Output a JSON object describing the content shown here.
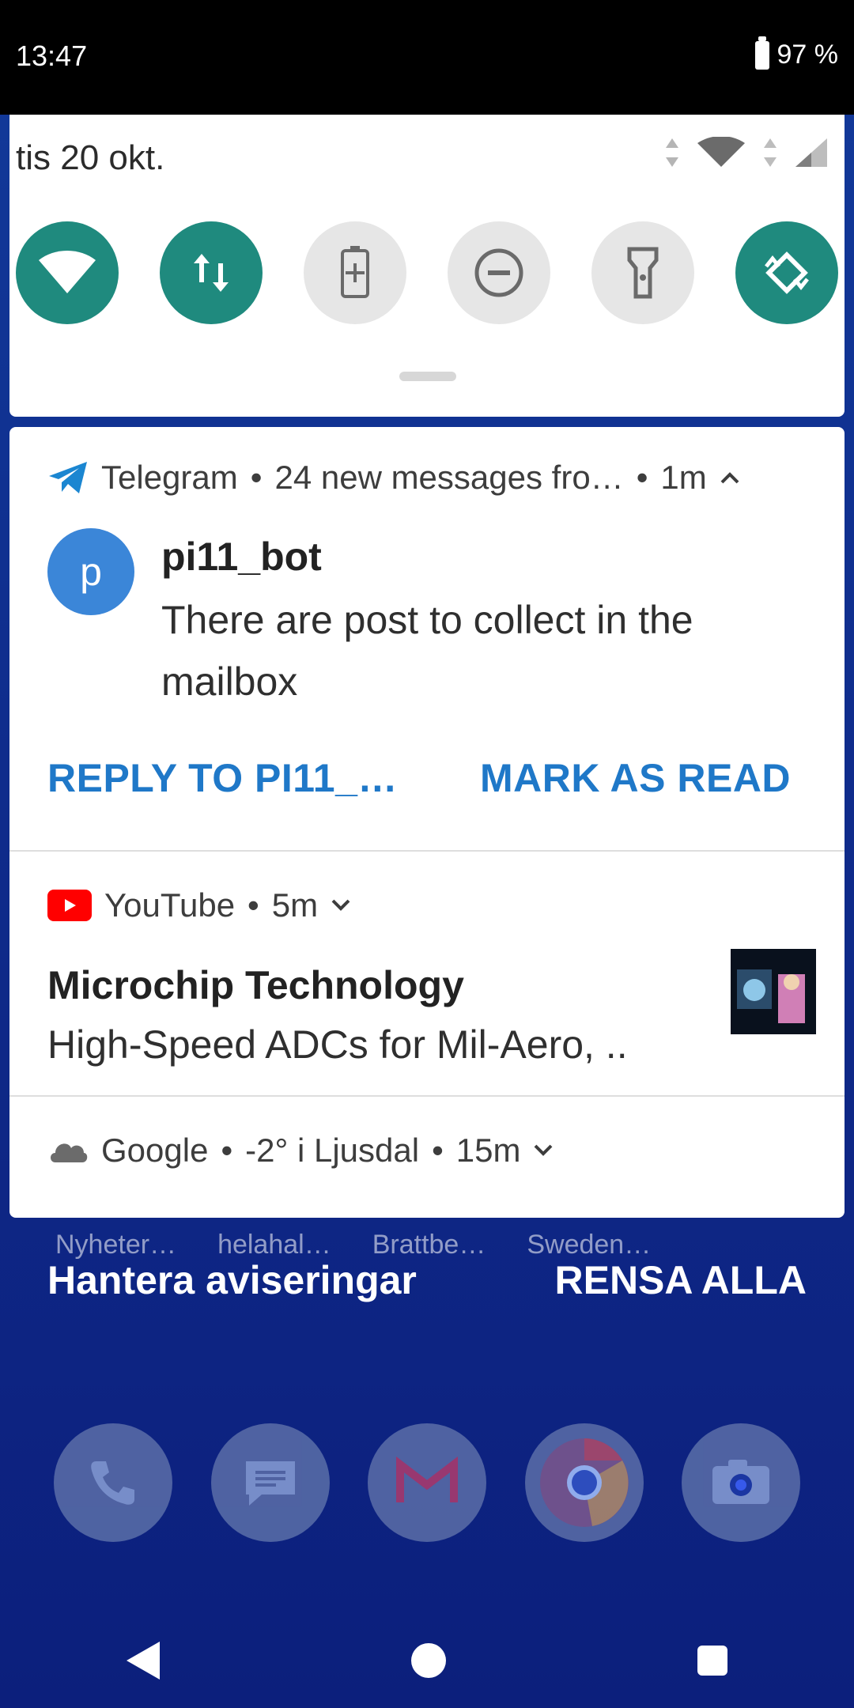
{
  "status_bar": {
    "time": "13:47",
    "battery": "97 %"
  },
  "quick_settings": {
    "date": "tis 20 okt.",
    "tiles": [
      {
        "name": "wifi",
        "active": true
      },
      {
        "name": "mobile-data",
        "active": true
      },
      {
        "name": "battery-saver",
        "active": false
      },
      {
        "name": "do-not-disturb",
        "active": false
      },
      {
        "name": "flashlight",
        "active": false
      },
      {
        "name": "auto-rotate",
        "active": true
      }
    ]
  },
  "notifications": {
    "telegram": {
      "app": "Telegram",
      "summary": "24 new messages fro…",
      "time": "1m",
      "sender": "pi11_bot",
      "avatar_letter": "p",
      "message": "There are post to collect in the mailbox",
      "actions": [
        "REPLY TO PI11_…",
        "MARK AS READ"
      ]
    },
    "youtube": {
      "app": "YouTube",
      "time": "5m",
      "title": "Microchip Technology",
      "body": "High-Speed ADCs for Mil-Aero, .."
    },
    "google": {
      "app": "Google",
      "summary": "-2° i Ljusdal",
      "time": "15m"
    }
  },
  "home": {
    "faded_labels": [
      "Nyheter…",
      "helahal…",
      "Brattbe…",
      "Sweden…"
    ],
    "manage_notifications": "Hantera aviseringar",
    "clear_all": "RENSA ALLA"
  },
  "colors": {
    "accent_teal": "#1f8a7e",
    "link_blue": "#1f78c8",
    "avatar_blue": "#3b86d8",
    "youtube_red": "#ff0000"
  }
}
